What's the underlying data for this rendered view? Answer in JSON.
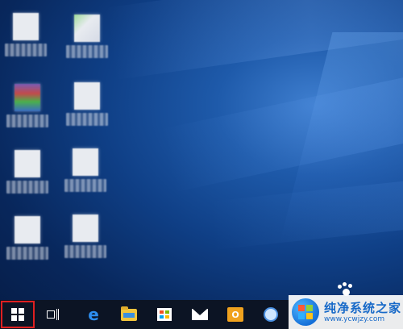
{
  "desktop": {
    "icons": [
      {
        "name": "desktop-icon-1",
        "style": "plain"
      },
      {
        "name": "desktop-icon-2",
        "style": "greenish"
      },
      {
        "name": "desktop-icon-3",
        "style": "colorful"
      },
      {
        "name": "desktop-icon-4",
        "style": "plain"
      },
      {
        "name": "desktop-icon-5",
        "style": "plain"
      },
      {
        "name": "desktop-icon-6",
        "style": "plain"
      },
      {
        "name": "desktop-icon-7",
        "style": "plain"
      },
      {
        "name": "desktop-icon-8",
        "style": "plain"
      }
    ]
  },
  "taskbar": {
    "items": [
      {
        "icon": "windows-start-icon",
        "highlighted": true
      },
      {
        "icon": "task-view-icon"
      },
      {
        "icon": "edge-browser-icon",
        "glyph": "e"
      },
      {
        "icon": "file-explorer-icon"
      },
      {
        "icon": "store-icon"
      },
      {
        "icon": "mail-icon"
      },
      {
        "icon": "outlook-icon",
        "glyph": "O"
      },
      {
        "icon": "app-icon"
      }
    ],
    "highlight_color": "#e02020",
    "background": "#0c1424"
  },
  "watermark": {
    "title": "纯净系统之家",
    "url": "www.ycwjzy.com",
    "color": "#1769c8"
  }
}
